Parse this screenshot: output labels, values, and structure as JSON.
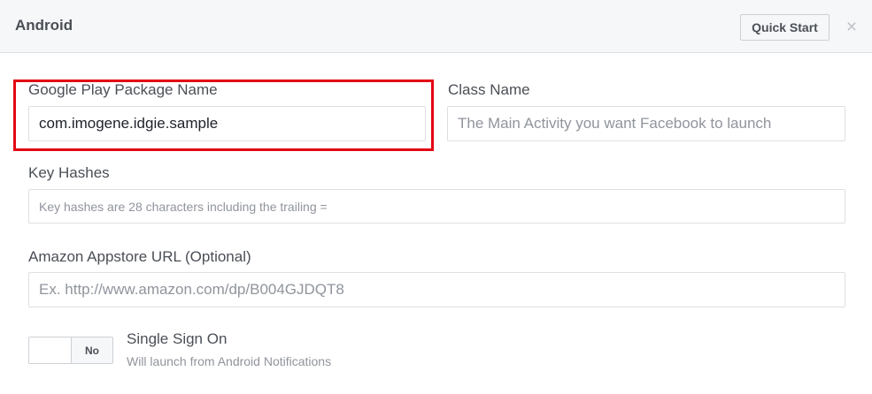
{
  "header": {
    "title": "Android",
    "quick_start_label": "Quick Start",
    "close_glyph": "×"
  },
  "form": {
    "package_name": {
      "label": "Google Play Package Name",
      "value": "com.imogene.idgie.sample"
    },
    "class_name": {
      "label": "Class Name",
      "placeholder": "The Main Activity you want Facebook to launch"
    },
    "key_hashes": {
      "label": "Key Hashes",
      "placeholder": "Key hashes are 28 characters including the trailing ="
    },
    "amazon_url": {
      "label": "Amazon Appstore URL (Optional)",
      "placeholder": "Ex. http://www.amazon.com/dp/B004GJDQT8"
    },
    "single_sign_on": {
      "title": "Single Sign On",
      "description": "Will launch from Android Notifications",
      "state_label": "No"
    }
  },
  "colors": {
    "highlight": "#e30613",
    "header_bg": "#f6f7f9",
    "border": "#dddfe2"
  }
}
